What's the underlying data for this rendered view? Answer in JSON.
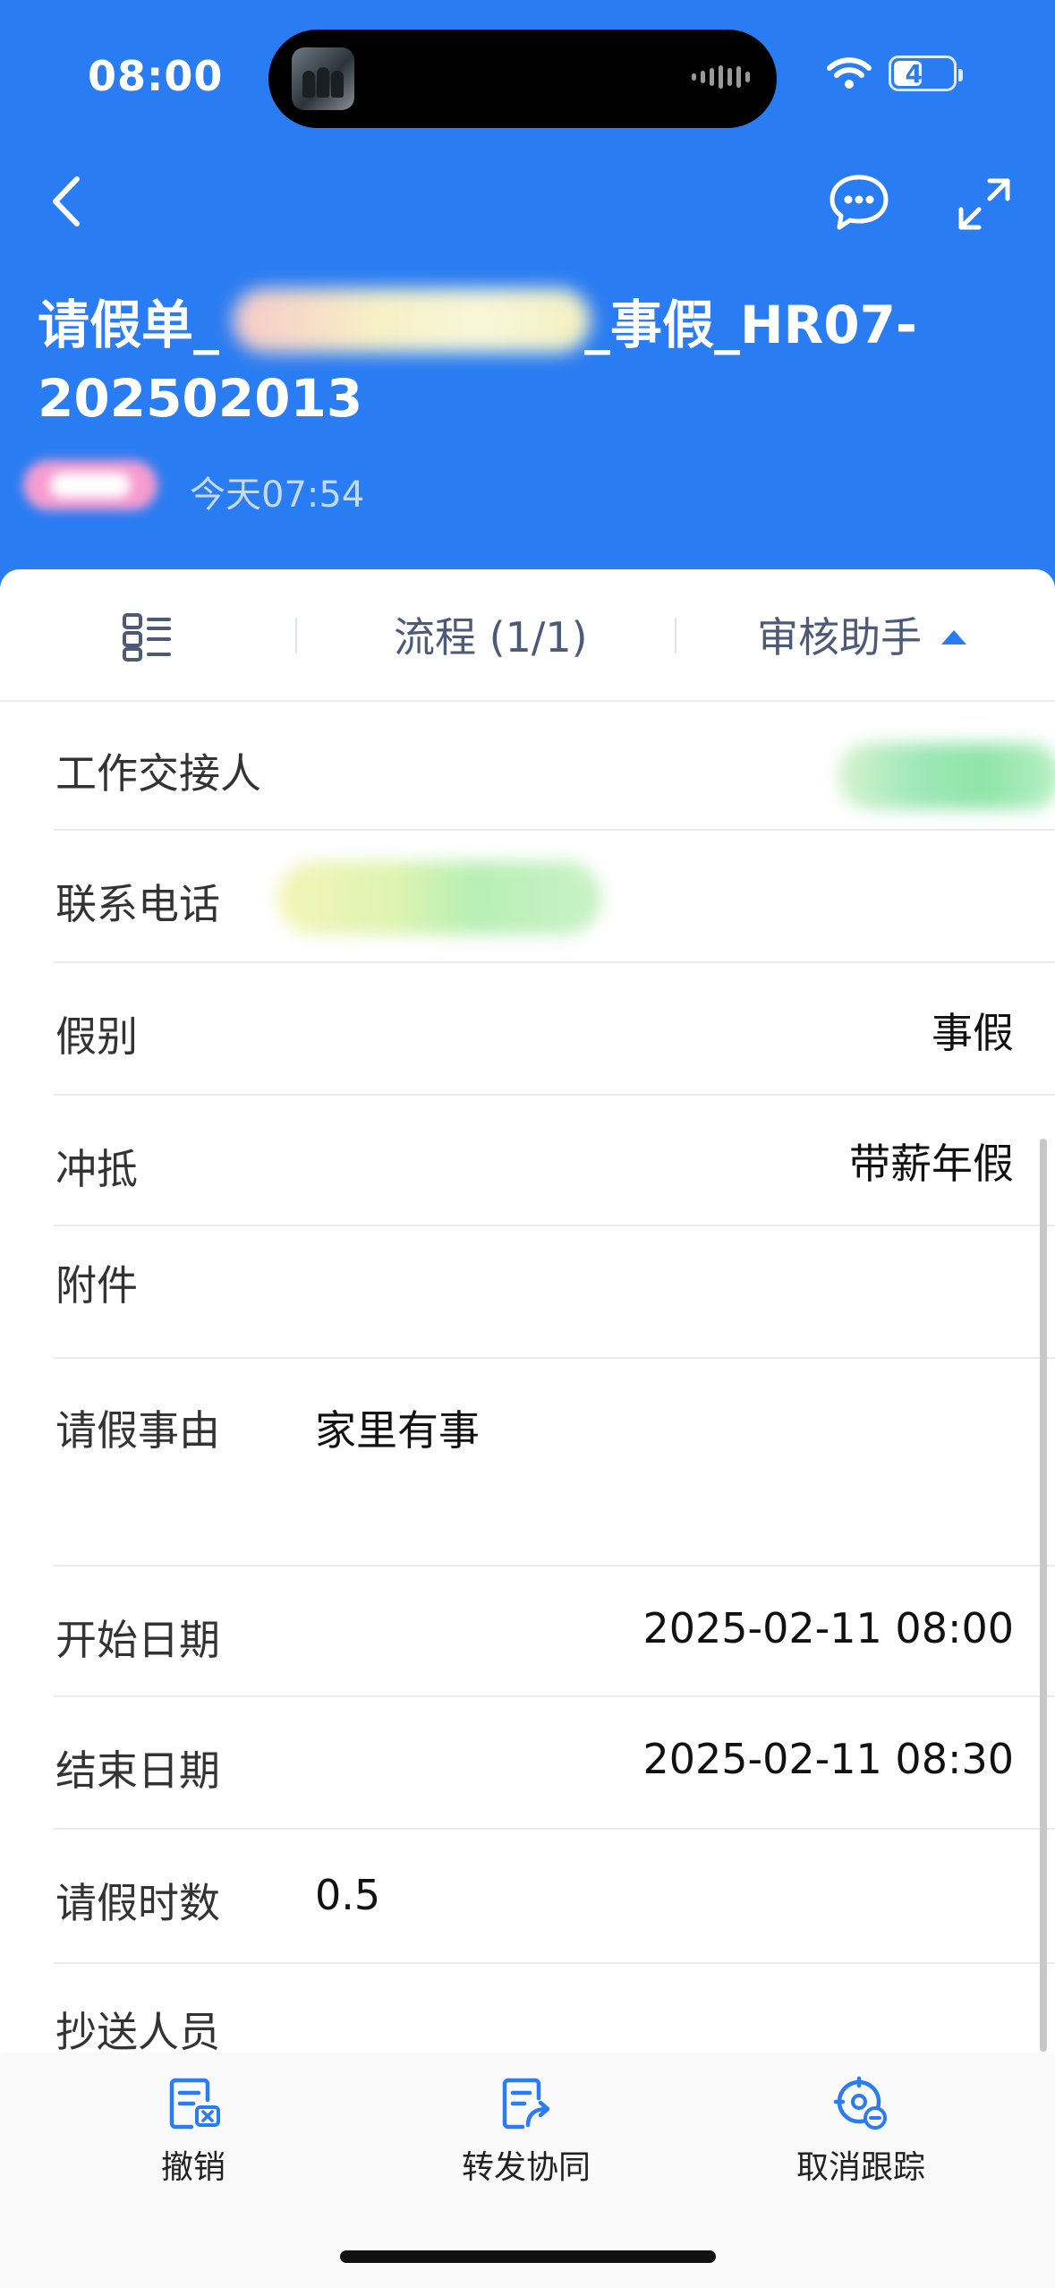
{
  "status_bar": {
    "time": "08:00",
    "battery": "49",
    "battery_level_percent": 49
  },
  "header": {
    "title_prefix": "请假单_",
    "title_suffix": "_事假_HR07-",
    "title_line2": "202502013",
    "timestamp": "今天07:54",
    "colors": {
      "background": "#2a7cf2",
      "text": "#ffffff"
    }
  },
  "icons": {
    "back": "chevron-left-icon",
    "chat": "chat-bubble-icon",
    "expand": "expand-icon",
    "form": "form-list-icon"
  },
  "tabs": {
    "process": "流程 (1/1)",
    "assistant": "审核助手"
  },
  "fields": {
    "handover": {
      "label": "工作交接人"
    },
    "phone": {
      "label": "联系电话"
    },
    "leave_type": {
      "label": "假别",
      "value": "事假"
    },
    "offset": {
      "label": "冲抵",
      "value": "带薪年假"
    },
    "attachment": {
      "label": "附件"
    },
    "reason": {
      "label": "请假事由",
      "value": "家里有事"
    },
    "start": {
      "label": "开始日期",
      "value": "2025-02-11 08:00"
    },
    "end": {
      "label": "结束日期",
      "value": "2025-02-11 08:30"
    },
    "hours": {
      "label": "请假时数",
      "value": "0.5"
    },
    "cc": {
      "label": "抄送人员"
    }
  },
  "actions": {
    "revoke": "撤销",
    "forward": "转发协同",
    "untrack": "取消跟踪"
  }
}
